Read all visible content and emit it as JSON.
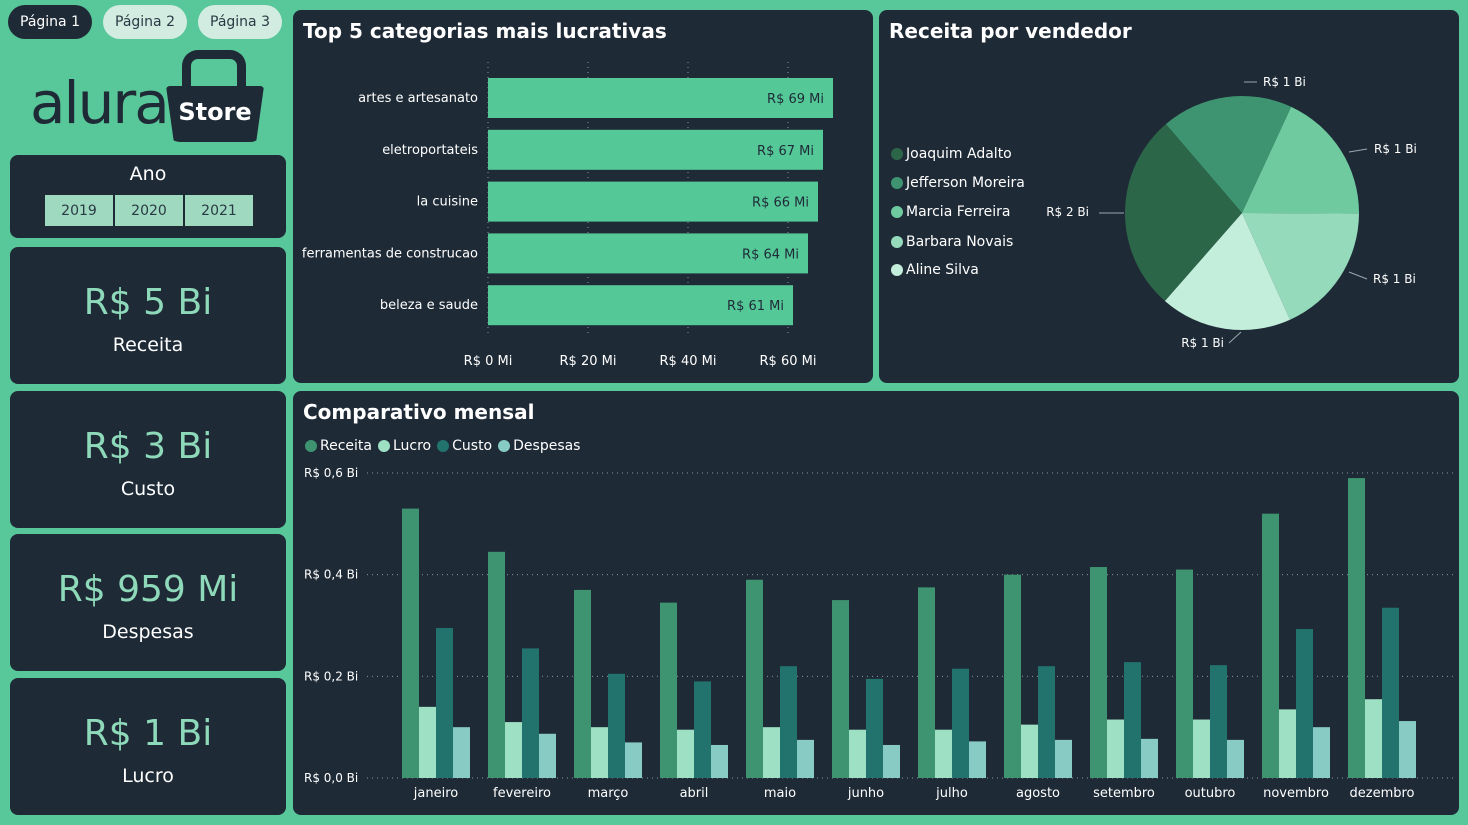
{
  "nav": {
    "pages": [
      "Página 1",
      "Página 2",
      "Página 3"
    ],
    "active": "Página 1"
  },
  "logo": {
    "brand": "alura",
    "store": "Store"
  },
  "year_filter": {
    "title": "Ano",
    "years": [
      "2019",
      "2020",
      "2021"
    ]
  },
  "kpis": [
    {
      "value": "R$ 5 Bi",
      "label": "Receita"
    },
    {
      "value": "R$ 3 Bi",
      "label": "Custo"
    },
    {
      "value": "R$ 959 Mi",
      "label": "Despesas"
    },
    {
      "value": "R$ 1 Bi",
      "label": "Lucro"
    }
  ],
  "colors": {
    "background": "#58c799",
    "panel": "#1e2a36",
    "bar_green": "#55c898",
    "receita": "#3e9470",
    "lucro": "#9de0c3",
    "custo": "#22726e",
    "despesas": "#88cbc5"
  },
  "top_categories": {
    "title": "Top 5 categorias mais lucrativas",
    "chart_data": {
      "type": "bar",
      "orientation": "horizontal",
      "categories": [
        "artes e artesanato",
        "eletroportateis",
        "la cuisine",
        "ferramentas de construcao",
        "beleza e saude"
      ],
      "values": [
        69,
        67,
        66,
        64,
        61
      ],
      "value_labels": [
        "R$ 69 Mi",
        "R$ 67 Mi",
        "R$ 66 Mi",
        "R$ 64 Mi",
        "R$ 61 Mi"
      ],
      "xticks": [
        "R$ 0 Mi",
        "R$ 20 Mi",
        "R$ 40 Mi",
        "R$ 60 Mi"
      ],
      "xtick_values": [
        0,
        20,
        40,
        60
      ],
      "xlim": [
        0,
        70
      ],
      "grid": "vertical dotted"
    }
  },
  "seller_revenue": {
    "title": "Receita por vendedor",
    "chart_data": {
      "type": "pie",
      "labels": [
        "Joaquim Adalto",
        "Jefferson Moreira",
        "Marcia Ferreira",
        "Barbara Novais",
        "Aline Silva"
      ],
      "values": [
        1.5,
        1.0,
        1.0,
        1.0,
        1.0
      ],
      "slice_labels": [
        "R$ 2 Bi",
        "R$ 1 Bi",
        "R$ 1 Bi",
        "R$ 1 Bi",
        "R$ 1 Bi"
      ],
      "colors": [
        "#2c6648",
        "#3e9470",
        "#6fcb9f",
        "#95dbbb",
        "#c3eedb"
      ],
      "legend": "left"
    }
  },
  "monthly": {
    "title": "Comparativo mensal",
    "chart_data": {
      "type": "bar",
      "categories": [
        "janeiro",
        "fevereiro",
        "março",
        "abril",
        "maio",
        "junho",
        "julho",
        "agosto",
        "setembro",
        "outubro",
        "novembro",
        "dezembro"
      ],
      "series": [
        {
          "name": "Receita",
          "values": [
            0.53,
            0.445,
            0.37,
            0.345,
            0.39,
            0.35,
            0.375,
            0.4,
            0.415,
            0.41,
            0.52,
            0.59
          ]
        },
        {
          "name": "Lucro",
          "values": [
            0.14,
            0.11,
            0.1,
            0.095,
            0.1,
            0.095,
            0.095,
            0.105,
            0.115,
            0.115,
            0.135,
            0.155
          ]
        },
        {
          "name": "Custo",
          "values": [
            0.295,
            0.255,
            0.205,
            0.19,
            0.22,
            0.195,
            0.215,
            0.22,
            0.228,
            0.222,
            0.293,
            0.335
          ]
        },
        {
          "name": "Despesas",
          "values": [
            0.1,
            0.087,
            0.07,
            0.065,
            0.075,
            0.065,
            0.072,
            0.075,
            0.077,
            0.075,
            0.1,
            0.112
          ]
        }
      ],
      "yticks": [
        "R$ 0,0 Bi",
        "R$ 0,2 Bi",
        "R$ 0,4 Bi",
        "R$ 0,6 Bi"
      ],
      "ytick_values": [
        0,
        0.2,
        0.4,
        0.6
      ],
      "ylim": [
        0,
        0.6
      ],
      "legend": "top-left",
      "grid": "horizontal dotted"
    }
  }
}
